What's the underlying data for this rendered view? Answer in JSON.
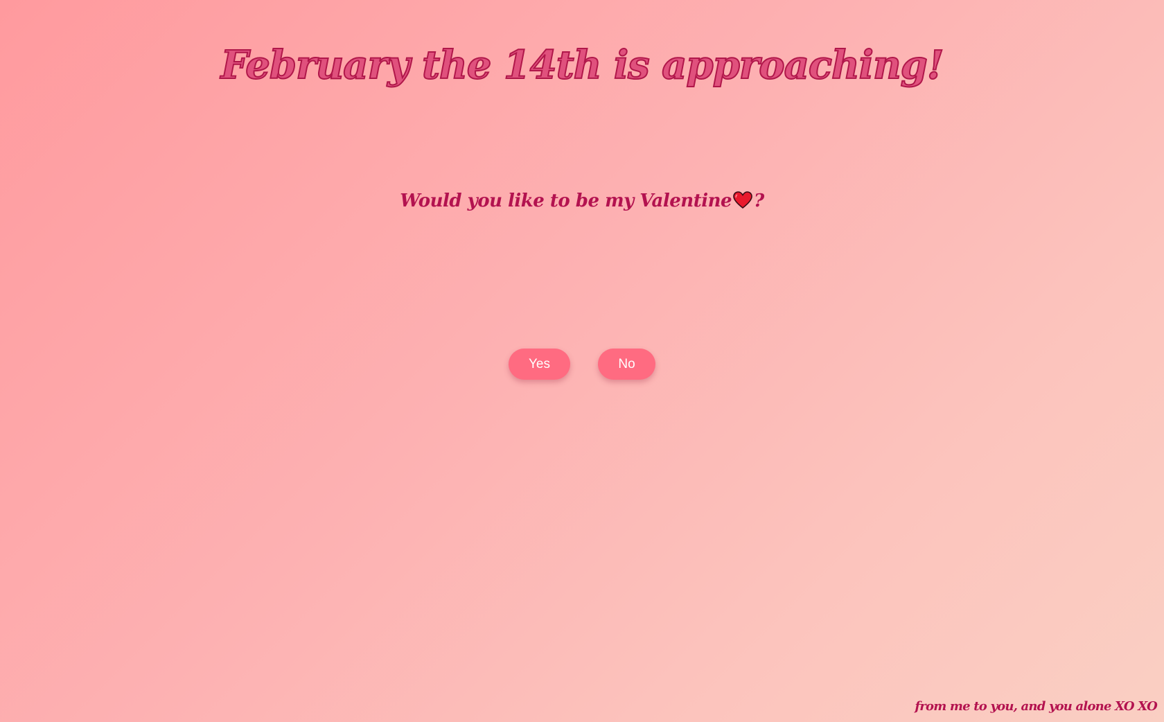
{
  "header": {
    "title": "February the 14th is approaching!"
  },
  "question": {
    "text": "Would you like to be my Valentine",
    "icon": "heart-icon",
    "suffix": "?"
  },
  "buttons": {
    "yes_label": "Yes",
    "no_label": "No"
  },
  "footer": {
    "note": "from me to you, and you alone XO XO"
  },
  "colors": {
    "accent": "#ff6b81",
    "title": "#e0517d",
    "title_outline": "#b0174a",
    "text": "#b3124f",
    "heart": "#e8192c"
  }
}
